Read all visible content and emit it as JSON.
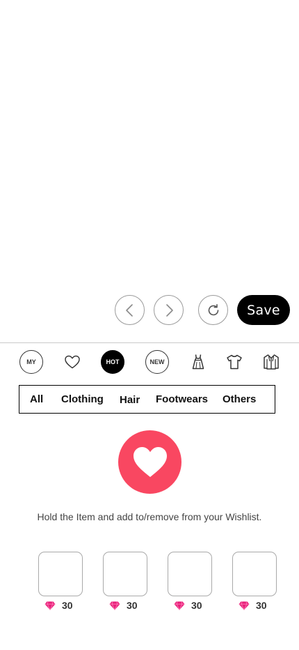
{
  "toolbar": {
    "save_label": "Save",
    "icons": [
      "chevron-left-icon",
      "chevron-right-icon",
      "refresh-icon"
    ]
  },
  "categories": {
    "my_label": "MY",
    "hot_label": "HOT",
    "new_label": "NEW",
    "icons": [
      "heart-outline-icon",
      "dress-icon",
      "tshirt-icon",
      "jacket-icon"
    ],
    "active": "HOT"
  },
  "filter_tabs": [
    "All",
    "Clothing",
    "Hair",
    "Footwears",
    "Others"
  ],
  "wishlist": {
    "hint": "Hold the Item and add to/remove from your Wishlist.",
    "accent": "#f94761"
  },
  "items": [
    {
      "price": "30"
    },
    {
      "price": "30"
    },
    {
      "price": "30"
    },
    {
      "price": "30"
    }
  ],
  "colors": {
    "gem": "#e8217a",
    "primary": "#000000"
  }
}
